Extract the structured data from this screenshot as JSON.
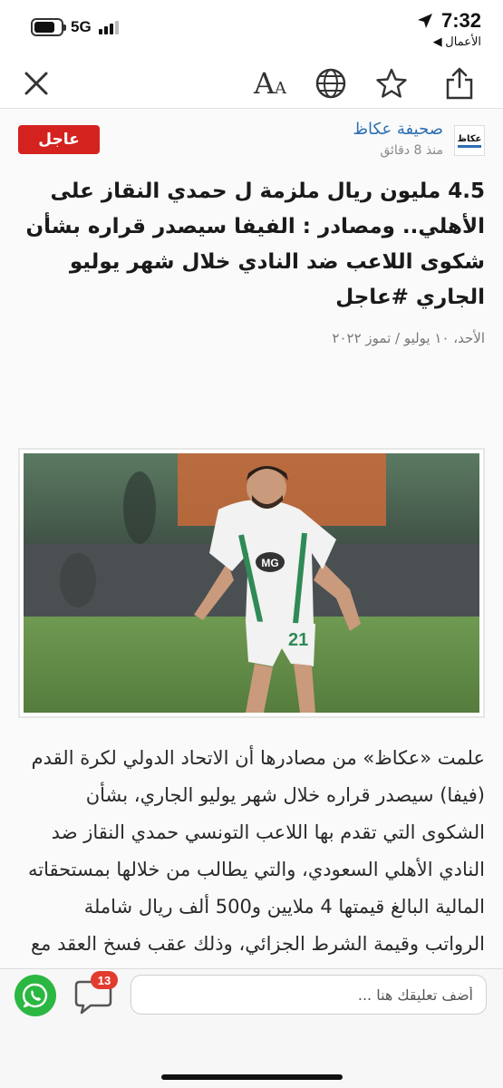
{
  "status_bar": {
    "time": "7:32",
    "network": "5G",
    "battery_level": 0.8,
    "back_app": "◀ الأعمال",
    "icons": [
      "battery-icon",
      "signal-icon",
      "location-arrow-icon"
    ]
  },
  "toolbar": {
    "font_size_label_big": "A",
    "font_size_label_small": "A",
    "icons": [
      "close-icon",
      "font-size-icon",
      "globe-icon",
      "star-icon",
      "share-icon"
    ]
  },
  "article": {
    "breaking_label": "عاجل",
    "source_name": "صحيفة عكاظ",
    "source_logo_text": "عكاظ",
    "time_ago": "منذ 8 دقائق",
    "headline": "4.5 مليون ريال ملزمة ل حمدي النقاز على الأهلي.. ومصادر : الفيفا سيصدر قراره بشأن شكوى اللاعب ضد النادي خلال شهر يوليو الجاري #عاجل",
    "date": "الأحد، ١٠ يوليو / تموز ٢٠٢٢",
    "photo_caption": "",
    "player_number": "21",
    "shirt_sponsor": "MG",
    "body": "علمت «عكاظ» من مصادرها أن الاتحاد الدولي لكرة القدم (فيفا) سيصدر قراره خلال شهر يوليو الجاري، بشأن الشكوى التي تقدم بها اللاعب التونسي حمدي النقاز ضد النادي الأهلي السعودي، والتي يطالب من خلالها بمستحقاته المالية البالغ قيمتها 4 ملايين و500 ألف ريال شاملة الرواتب وقيمة الشرط الجزائي، وذلك عقب فسخ العقد مع اللاعب من طرف"
  },
  "bottom_bar": {
    "comment_placeholder": "أضف تعليقك هنا ...",
    "comments_count": "13",
    "icons": [
      "comment-bubble-icon",
      "whatsapp-icon"
    ]
  },
  "colors": {
    "breaking_red": "#d4231f",
    "source_blue": "#2e6fb3",
    "whatsapp_green": "#2bb741",
    "badge_red": "#e23b2f"
  }
}
